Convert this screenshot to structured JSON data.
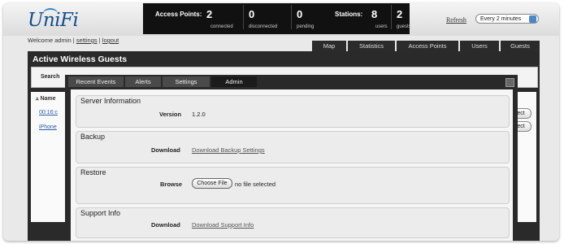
{
  "app": {
    "logo": "UniFi"
  },
  "stats": {
    "access_points_label": "Access Points:",
    "connected_value": "2",
    "connected_label": "connected",
    "disconnected_value": "0",
    "disconnected_label": "disconnected",
    "pending_value": "0",
    "pending_label": "pending",
    "stations_label": "Stations:",
    "users_value": "8",
    "users_label": "users",
    "guests_value": "2",
    "guests_label": "guests"
  },
  "refresh": {
    "label": "Refresh",
    "selected": "Every 2 minutes"
  },
  "welcome": {
    "text": "Welcome admin",
    "settings": "settings",
    "logout": "logout",
    "sep": "|"
  },
  "nav_tabs": [
    "Map",
    "Statistics",
    "Access Points",
    "Users",
    "Guests"
  ],
  "main": {
    "title": "Active Wireless Guests",
    "search_label": "Search",
    "col_name": "Name",
    "rows": [
      "00:16:c",
      "iPhone"
    ],
    "row_button": "ect"
  },
  "modal": {
    "tabs": [
      "Recent Events",
      "Alerts",
      "Settings",
      "Admin"
    ],
    "active_tab": "Admin",
    "sections": {
      "server": {
        "title": "Server Information",
        "label": "Version",
        "value": "1.2.0"
      },
      "backup": {
        "title": "Backup",
        "label": "Download",
        "link": "Download Backup Settings"
      },
      "restore": {
        "title": "Restore",
        "label": "Browse",
        "button": "Choose File",
        "status": "no file selected"
      },
      "support": {
        "title": "Support Info",
        "label": "Download",
        "link": "Download Support Info"
      }
    }
  }
}
